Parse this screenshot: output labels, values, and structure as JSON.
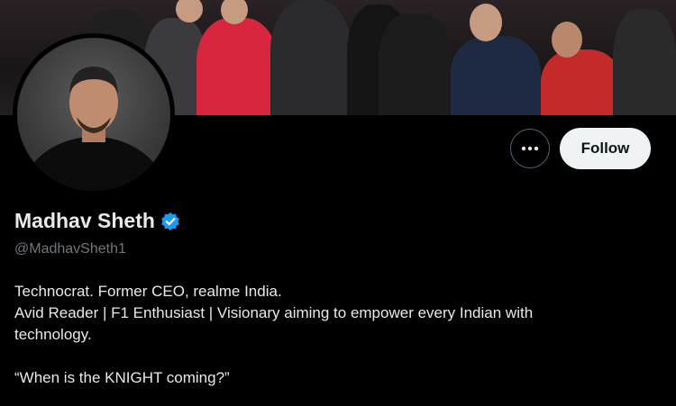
{
  "profile": {
    "display_name": "Madhav Sheth",
    "handle": "@MadhavSheth1",
    "verified_icon": "verified-badge-icon",
    "bio_lines": [
      "Technocrat. Former CEO, realme India.",
      "Avid Reader | F1 Enthusiast | Visionary aiming to empower every Indian with",
      "technology.",
      "",
      "“When is the KNIGHT coming?”"
    ]
  },
  "actions": {
    "more_icon": "more-horizontal-icon",
    "follow_label": "Follow"
  },
  "colors": {
    "background": "#000000",
    "text_primary": "#e7e9ea",
    "text_secondary": "#71767b",
    "verified_blue": "#1d9bf0",
    "button_bg": "#eff3f4"
  }
}
